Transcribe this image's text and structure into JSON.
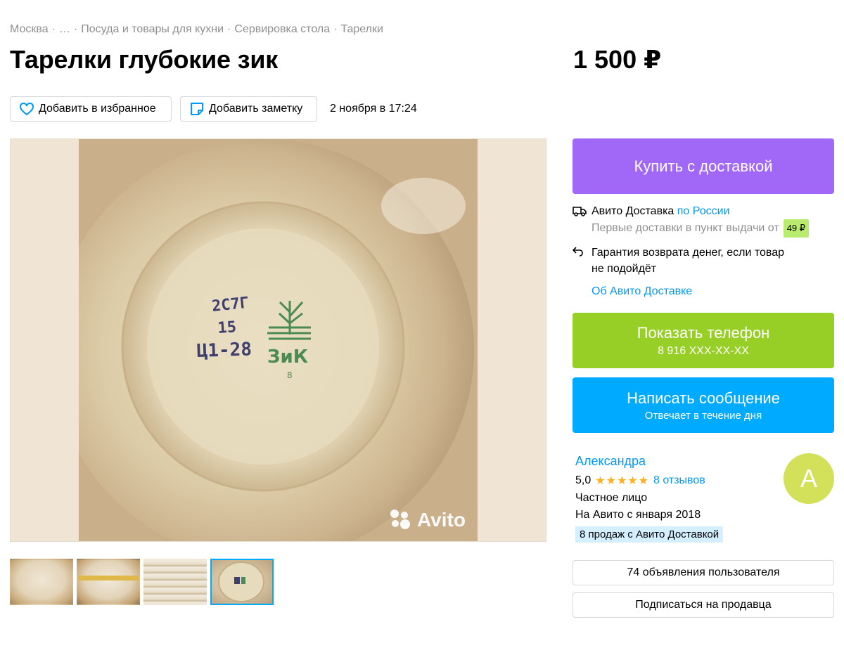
{
  "breadcrumbs": [
    "Москва",
    "…",
    "Посуда и товары для кухни",
    "Сервировка стола",
    "Тарелки"
  ],
  "breadcrumb_separator": "·",
  "listing": {
    "title": "Тарелки глубокие зик",
    "price": "1 500 ₽",
    "date": "2 ноября в 17:24"
  },
  "actions": {
    "favorite_label": "Добавить в избранное",
    "note_label": "Добавить заметку"
  },
  "gallery": {
    "watermark": "Avito",
    "photo_stamp": [
      "2С7Г",
      "15",
      "Ц1-28",
      "ЗиК",
      "8"
    ],
    "thumbnail_count": 4,
    "active_thumbnail": 4
  },
  "buy": {
    "label": "Купить с доставкой"
  },
  "delivery": {
    "name": "Авито Доставка",
    "region_link": "по России",
    "first_delivery_text": "Первые доставки в пункт выдачи от",
    "first_delivery_price": "49 ₽",
    "guarantee_line1": "Гарантия возврата денег, если товар",
    "guarantee_line2": "не подойдёт",
    "about_link": "Об Авито Доставке"
  },
  "phone": {
    "label": "Показать телефон",
    "number": "8 916 XXX-XX-XX"
  },
  "message": {
    "label": "Написать сообщение",
    "sub": "Отвечает в течение дня"
  },
  "seller": {
    "name": "Александра",
    "rating": "5,0",
    "stars": "★★★★★",
    "reviews": "8 отзывов",
    "type": "Частное лицо",
    "since": "На Авито с января 2018",
    "sales_badge": "8 продаж с Авито Доставкой",
    "avatar_letter": "А"
  },
  "seller_actions": {
    "ads_label": "74 объявления пользователя",
    "subscribe_label": "Подписаться на продавца"
  },
  "colors": {
    "buy": "#a168f7",
    "phone": "#97cf26",
    "message": "#00aaff",
    "link": "#0099f7",
    "avatar": "#d3e05a",
    "star": "#ffb021"
  },
  "icons": [
    "heart-icon",
    "note-icon",
    "truck-icon",
    "return-arrow-icon",
    "avito-logo-icon"
  ]
}
